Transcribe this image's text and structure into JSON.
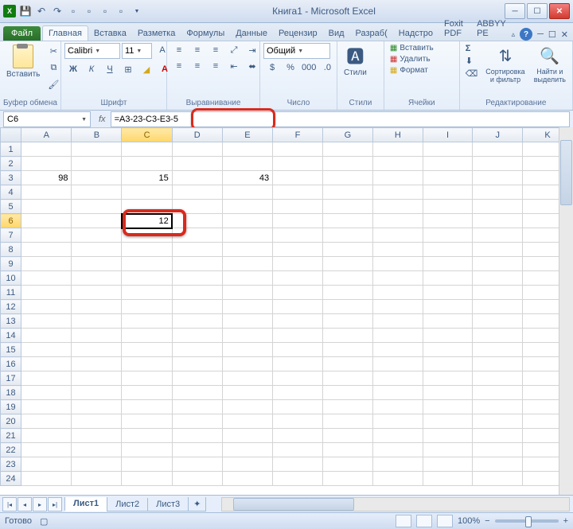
{
  "title": "Книга1 - Microsoft Excel",
  "tabs": {
    "file": "Файл",
    "home": "Главная",
    "insert": "Вставка",
    "layout": "Разметка",
    "formulas": "Формулы",
    "data": "Данные",
    "review": "Рецензир",
    "view": "Вид",
    "dev": "Разраб(",
    "addins": "Надстро",
    "foxit": "Foxit PDF",
    "abbyy": "ABBYY PE"
  },
  "ribbon": {
    "paste": "Вставить",
    "clipboard_label": "Буфер обмена",
    "font_label": "Шрифт",
    "align_label": "Выравнивание",
    "number_label": "Число",
    "styles_label": "Стили",
    "cells_label": "Ячейки",
    "editing_label": "Редактирование",
    "font_name": "Calibri",
    "font_size": "11",
    "number_format": "Общий",
    "insert_cell": "Вставить",
    "delete_cell": "Удалить",
    "format_cell": "Формат",
    "sort": "Сортировка и фильтр",
    "find": "Найти и выделить",
    "styles": "Стили"
  },
  "name_box": "C6",
  "formula": "=A3-23-C3-E3-5",
  "columns": [
    "A",
    "B",
    "C",
    "D",
    "E",
    "F",
    "G",
    "H",
    "I",
    "J",
    "K"
  ],
  "rows": [
    "1",
    "2",
    "3",
    "4",
    "5",
    "6",
    "7",
    "8",
    "9",
    "10",
    "11",
    "12",
    "13",
    "14",
    "15",
    "16",
    "17",
    "18",
    "19",
    "20",
    "21",
    "22",
    "23",
    "24"
  ],
  "cells": {
    "A3": "98",
    "C3": "15",
    "E3": "43",
    "C6": "12"
  },
  "active": {
    "row": "6",
    "col": "C"
  },
  "sheets": {
    "s1": "Лист1",
    "s2": "Лист2",
    "s3": "Лист3"
  },
  "status": "Готово",
  "zoom": "100%"
}
